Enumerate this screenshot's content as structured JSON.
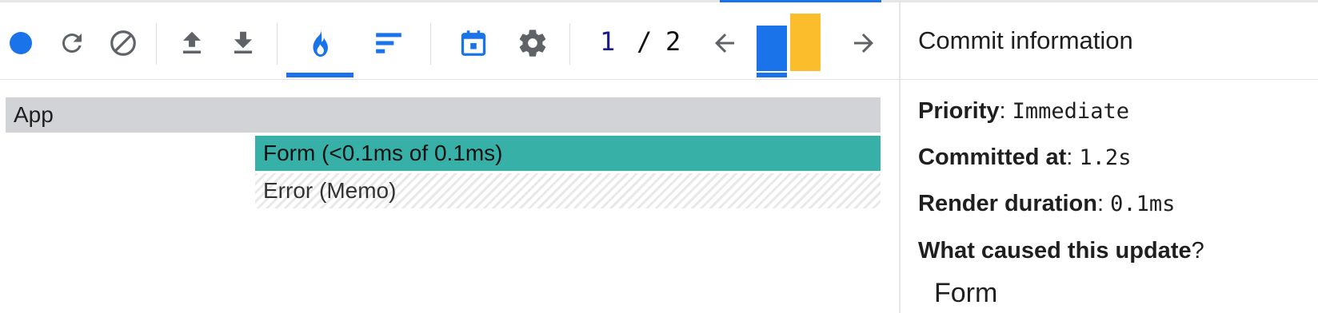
{
  "colors": {
    "accent": "#1a73e8",
    "record_dot": "#1a73e8",
    "icon_gray": "#5f6368",
    "bar_selected": "#1a73e8",
    "bar_other": "#fcbd2c",
    "flame_app": "#d2d3d6",
    "flame_form": "#37b0a8"
  },
  "toolbar": {
    "icons": [
      "record-icon",
      "reload-icon",
      "clear-icon",
      "upload-icon",
      "download-icon",
      "flame-chart-icon",
      "ranked-chart-icon",
      "timeline-icon",
      "settings-icon",
      "prev-arrow-icon",
      "next-arrow-icon"
    ],
    "commit_current": "1",
    "commit_separator": "/",
    "commit_total": "2",
    "commit_bars_relative_height": [
      0.79,
      1.0
    ]
  },
  "flamegraph": {
    "rows": [
      {
        "label": "App"
      },
      {
        "label": "Form (<0.1ms of 0.1ms)"
      },
      {
        "label": "Error (Memo)"
      }
    ]
  },
  "panel": {
    "title": "Commit information",
    "priority_label": "Priority",
    "priority_value": "Immediate",
    "committed_label": "Committed at",
    "committed_value": "1.2s",
    "duration_label": "Render duration",
    "duration_value": "0.1ms",
    "cause_label": "What caused this update",
    "cause_item": "Form"
  }
}
